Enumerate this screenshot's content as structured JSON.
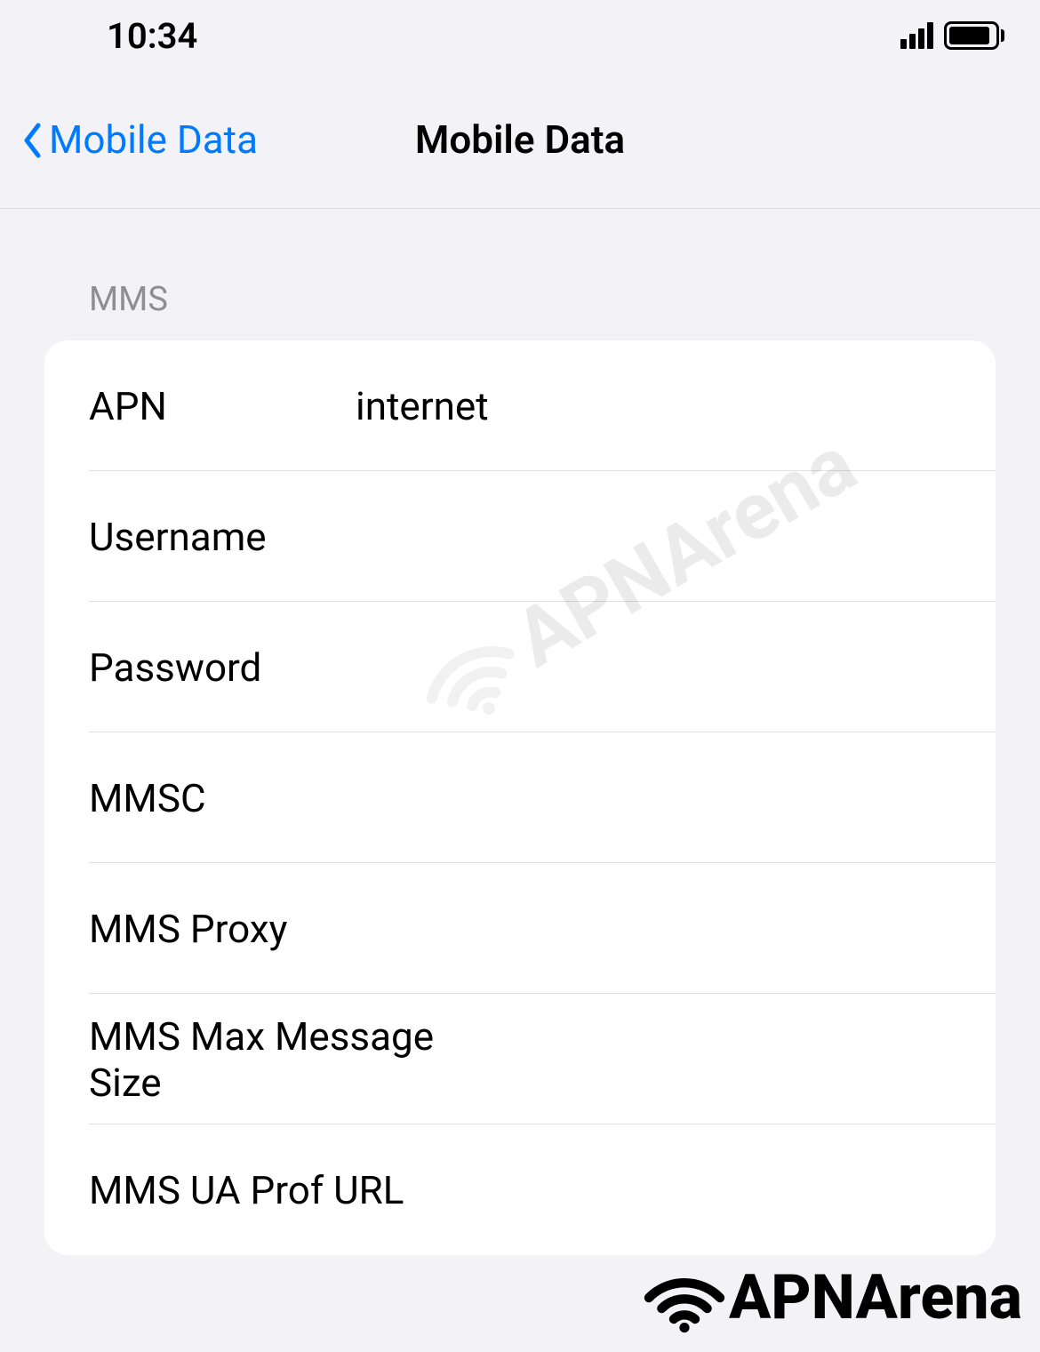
{
  "statusBar": {
    "time": "10:34"
  },
  "nav": {
    "backLabel": "Mobile Data",
    "title": "Mobile Data"
  },
  "section": {
    "header": "MMS",
    "rows": {
      "apn": {
        "label": "APN",
        "value": "internet"
      },
      "username": {
        "label": "Username",
        "value": ""
      },
      "password": {
        "label": "Password",
        "value": ""
      },
      "mmsc": {
        "label": "MMSC",
        "value": ""
      },
      "mmsProxy": {
        "label": "MMS Proxy",
        "value": ""
      },
      "mmsMaxSize": {
        "label": "MMS Max Message Size",
        "value": ""
      },
      "mmsUaProf": {
        "label": "MMS UA Prof URL",
        "value": ""
      }
    }
  },
  "watermark": "APNArena",
  "footerLogo": "APNArena"
}
